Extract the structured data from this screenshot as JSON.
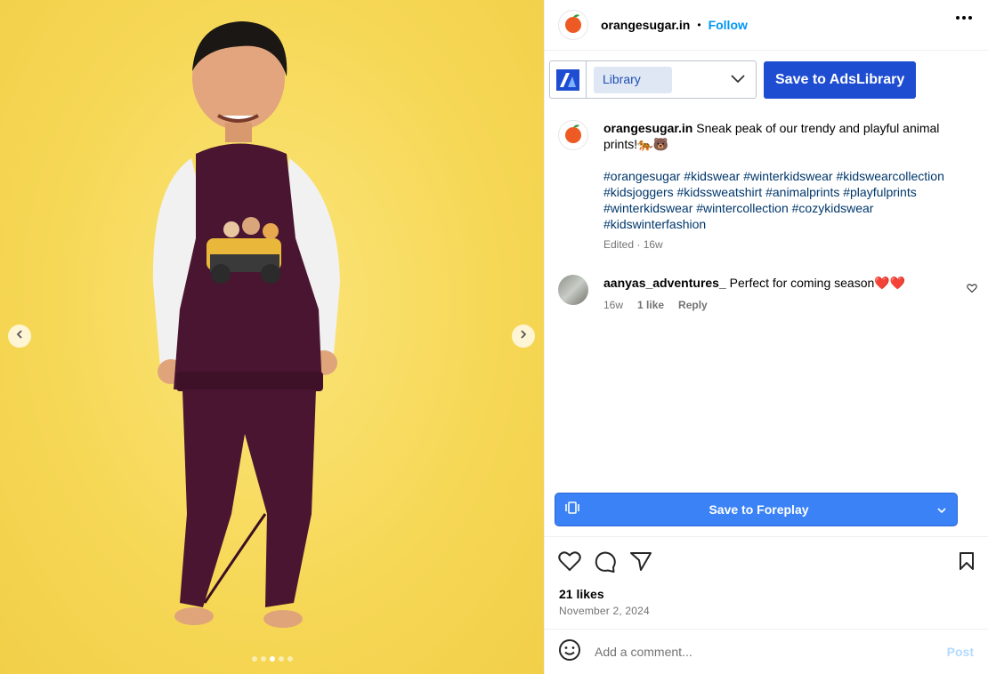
{
  "post": {
    "username": "orangesugar.in",
    "separator": "•",
    "follow_label": "Follow",
    "caption_text": "Sneak peak of our trendy and playful animal prints!🐅🐻",
    "hashtags": "#orangesugar #kidswear #winterkidswear #kidswearcollection #kidsjoggers #kidssweatshirt #animalprints #playfulprints #winterkidswear #wintercollection #cozykidswear #kidswinterfashion",
    "caption_meta": "Edited · 16w",
    "likes": "21 likes",
    "date": "November 2, 2024"
  },
  "adslibrary": {
    "select_value": "Library",
    "save_label": "Save to AdsLibrary"
  },
  "comment": {
    "username": "aanyas_adventures_",
    "text": "Perfect for coming season❤️❤️",
    "age": "16w",
    "likes": "1 like",
    "reply_label": "Reply"
  },
  "foreplay": {
    "save_label": "Save to Foreplay"
  },
  "comment_box": {
    "placeholder": "Add a comment...",
    "post_label": "Post"
  },
  "carousel": {
    "slide_count": 5,
    "active_index": 2
  },
  "colors": {
    "background": "#f7d85a",
    "link_blue": "#0095f6",
    "hashtag": "#00376b",
    "ads_button": "#1f4dd1",
    "foreplay_button": "#3b82f6",
    "sweatshirt": "#4a1530"
  },
  "icons": [
    "chevron-left-icon",
    "chevron-right-icon",
    "more-icon",
    "chevron-down-icon",
    "heart-icon",
    "comment-icon",
    "share-icon",
    "bookmark-icon",
    "emoji-icon",
    "foreplay-icon",
    "orange-logo-icon",
    "adslibrary-logo-icon"
  ]
}
